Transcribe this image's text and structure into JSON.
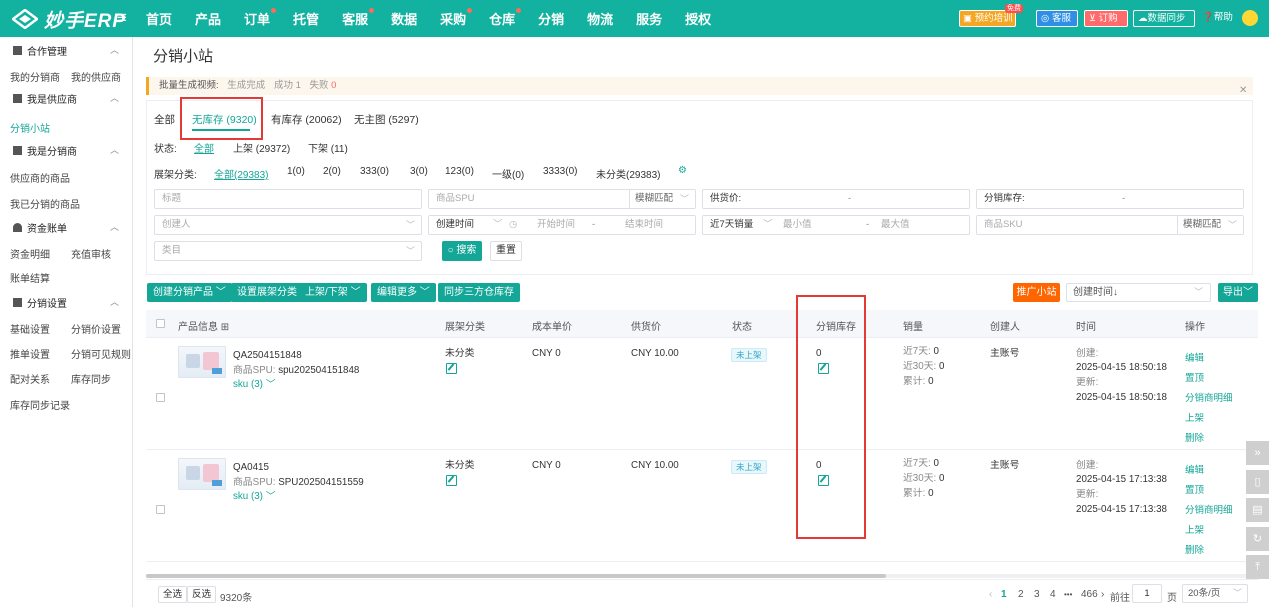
{
  "app": {
    "logo_text": "妙手ERP",
    "menu_icon": "menu-icon"
  },
  "nav": [
    {
      "label": "首页",
      "dot": false
    },
    {
      "label": "产品",
      "dot": false
    },
    {
      "label": "订单",
      "dot": true
    },
    {
      "label": "托管",
      "dot": false
    },
    {
      "label": "客服",
      "dot": true
    },
    {
      "label": "数据",
      "dot": false
    },
    {
      "label": "采购",
      "dot": true
    },
    {
      "label": "仓库",
      "dot": true
    },
    {
      "label": "分销",
      "dot": false
    },
    {
      "label": "物流",
      "dot": false
    },
    {
      "label": "服务",
      "dot": false
    },
    {
      "label": "授权",
      "dot": false
    }
  ],
  "topright": {
    "training": "预约培训",
    "free": "免费",
    "cs": "客服",
    "order": "订购",
    "sync": "数据同步",
    "help": "帮助"
  },
  "sidebar": {
    "groups": [
      {
        "label": "合作管理",
        "items": [
          "我的分销商",
          "我的供应商"
        ]
      },
      {
        "label": "我是供应商",
        "items": [
          "分销小站"
        ]
      },
      {
        "label": "我是分销商",
        "items": [
          "供应商的商品",
          "我已分销的商品"
        ]
      },
      {
        "label": "资金账单",
        "items": [
          "资金明细",
          "充值审核",
          "账单结算"
        ]
      },
      {
        "label": "分销设置",
        "items": [
          "基础设置",
          "分销价设置",
          "推单设置",
          "分销可见规则",
          "配对关系",
          "库存同步",
          "库存同步记录"
        ]
      }
    ],
    "active": "分销小站"
  },
  "page": {
    "title": "分销小站"
  },
  "notice": {
    "label": "批量生成视频:",
    "status": "生成完成",
    "success": "成功 1",
    "fail": "失败",
    "fail_count": "0",
    "close_icon": "close-icon"
  },
  "tabs": [
    {
      "label": "全部"
    },
    {
      "label": "无库存 (9320)"
    },
    {
      "label": "有库存 (20062)"
    },
    {
      "label": "无主图 (5297)"
    }
  ],
  "status_filter": {
    "label": "状态:",
    "options": [
      "全部",
      "上架 (29372)",
      "下架 (11)"
    ]
  },
  "category_filter": {
    "label": "展架分类:",
    "options": [
      "全部(29383)",
      "1(0)",
      "2(0)",
      "333(0)",
      "3(0)",
      "123(0)",
      "一级(0)",
      "3333(0)",
      "未分类(29383)"
    ]
  },
  "search": {
    "title": "标题",
    "spu": "商品SPU",
    "match1": "模糊匹配",
    "price": "供货价:",
    "stock": "分销库存:",
    "creator": "创建人",
    "time_type": "创建时间",
    "start_time": "开始时间",
    "end_time": "结束时间",
    "sales_type": "近7天销量",
    "min": "最小值",
    "max": "最大值",
    "sku": "商品SKU",
    "match2": "模糊匹配",
    "category": "类目",
    "search_btn": "搜索",
    "reset_btn": "重置",
    "range_sep": "-"
  },
  "actions": {
    "create": "创建分销产品",
    "set_category": "设置展架分类",
    "shelf": "上架/下架",
    "edit_more": "编辑更多",
    "sync_stock": "同步三方仓库存",
    "promote": "推广小站",
    "sort": "创建时间↓",
    "export": "导出"
  },
  "table": {
    "headers": {
      "product": "产品信息",
      "category": "展架分类",
      "cost": "成本单价",
      "supply": "供货价",
      "status": "状态",
      "stock": "分销库存",
      "sales": "销量",
      "creator": "创建人",
      "time": "时间",
      "ops": "操作"
    },
    "rows": [
      {
        "name": "QA2504151848",
        "spu_label": "商品SPU:",
        "spu": "spu202504151848",
        "sku": "sku (3)",
        "category": "未分类",
        "cost": "CNY 0",
        "supply": "CNY 10.00",
        "status": "未上架",
        "stock": "0",
        "sales7_label": "近7天:",
        "sales7": "0",
        "sales30_label": "近30天:",
        "sales30": "0",
        "total_label": "累计:",
        "total": "0",
        "creator": "主账号",
        "created_label": "创建:",
        "created": "2025-04-15 18:50:18",
        "updated_label": "更新:",
        "updated": "2025-04-15 18:50:18",
        "ops": [
          "编辑",
          "置顶",
          "分销商明细",
          "上架",
          "删除"
        ]
      },
      {
        "name": "QA0415",
        "spu_label": "商品SPU:",
        "spu": "SPU202504151559",
        "sku": "sku (3)",
        "category": "未分类",
        "cost": "CNY 0",
        "supply": "CNY 10.00",
        "status": "未上架",
        "stock": "0",
        "sales7_label": "近7天:",
        "sales7": "0",
        "sales30_label": "近30天:",
        "sales30": "0",
        "total_label": "累计:",
        "total": "0",
        "creator": "主账号",
        "created_label": "创建:",
        "created": "2025-04-15 17:13:38",
        "updated_label": "更新:",
        "updated": "2025-04-15 17:13:38",
        "ops": [
          "编辑",
          "置顶",
          "分销商明细",
          "上架",
          "删除"
        ]
      }
    ]
  },
  "footer": {
    "select_all": "全选",
    "invert": "反选",
    "count": "9320条",
    "pages": [
      "1",
      "2",
      "3",
      "4"
    ],
    "ellipsis": "•••",
    "last_page": "466",
    "goto_label": "前往",
    "goto_value": "1",
    "page_unit": "页",
    "page_size": "20条/页"
  },
  "colors": {
    "brand": "#12b1a0",
    "accent": "#14a697",
    "highlight": "#e53935",
    "promo": "#ff6600"
  }
}
